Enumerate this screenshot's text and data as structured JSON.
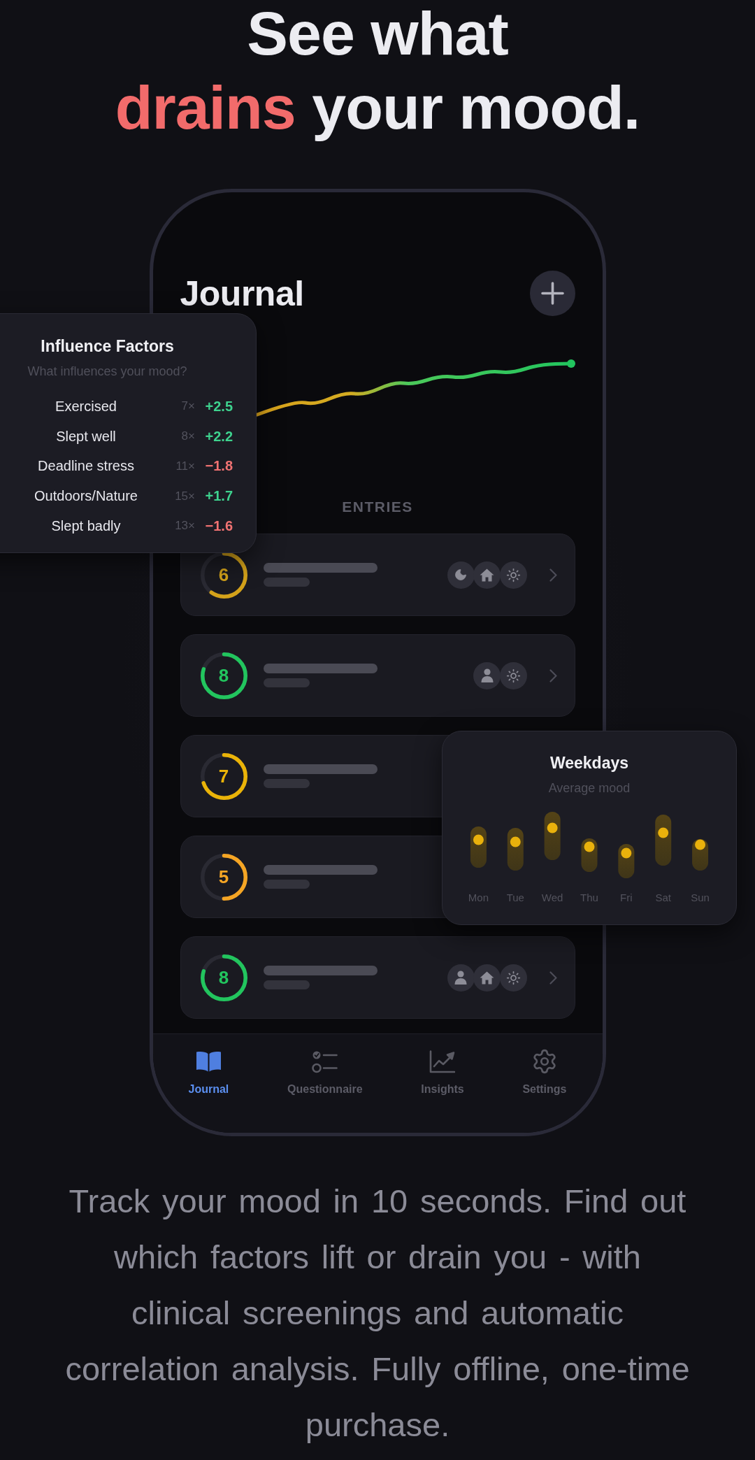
{
  "headline": {
    "lines": [
      [
        {
          "text": "See what",
          "accent": false
        }
      ],
      [
        {
          "text": "drains",
          "accent": true
        },
        {
          "text": "your mood.",
          "accent": false
        }
      ]
    ]
  },
  "phone": {
    "title": "Journal",
    "section_label": "ENTRIES",
    "entries": [
      {
        "score": "6",
        "level": 0.6,
        "color": "#d4a21a",
        "tags": [
          {
            "kind": "moon"
          },
          {
            "kind": "home"
          },
          {
            "kind": "sun"
          }
        ]
      },
      {
        "score": "8",
        "level": 0.8,
        "color": "#22c55e",
        "tags": [
          {
            "kind": "person"
          },
          {
            "kind": "sun"
          }
        ]
      },
      {
        "score": "7",
        "level": 0.7,
        "color": "#eab308"
      },
      {
        "score": "5",
        "level": 0.5,
        "color": "#f5a524"
      },
      {
        "score": "8",
        "level": 0.8,
        "color": "#22c55e",
        "tags": [
          {
            "kind": "person"
          },
          {
            "kind": "home"
          },
          {
            "kind": "sun"
          }
        ]
      }
    ],
    "tabs": [
      {
        "label": "Journal",
        "kind": "book",
        "selected": true
      },
      {
        "label": "Questionnaire",
        "kind": "checklist",
        "selected": false
      },
      {
        "label": "Insights",
        "kind": "chart",
        "selected": false
      },
      {
        "label": "Settings",
        "kind": "gear",
        "selected": false
      }
    ]
  },
  "influence_card": {
    "title": "Influence Factors",
    "subtitle": "What influences your mood?",
    "factors": [
      {
        "label": "Exercised",
        "count": "7×",
        "effect": "+2.5",
        "color": "#3ed28e"
      },
      {
        "label": "Slept well",
        "count": "8×",
        "effect": "+2.2",
        "color": "#3ed28e"
      },
      {
        "label": "Deadline stress",
        "count": "11×",
        "effect": "−1.8",
        "color": "#f07272"
      },
      {
        "label": "Outdoors/Nature",
        "count": "15×",
        "effect": "+1.7",
        "color": "#3ed28e"
      },
      {
        "label": "Slept badly",
        "count": "13×",
        "effect": "−1.6",
        "color": "#f07272"
      }
    ]
  },
  "weekdays_card": {
    "title": "Weekdays",
    "subtitle": "Average mood",
    "days": [
      "Mon",
      "Tue",
      "Wed",
      "Thu",
      "Fri",
      "Sat",
      "Sun"
    ]
  },
  "description": "Track your mood in 10 seconds. Find out which factors lift or drain you - with clinical screenings and automatic correlation analysis. Fully offline, one-time purchase."
}
